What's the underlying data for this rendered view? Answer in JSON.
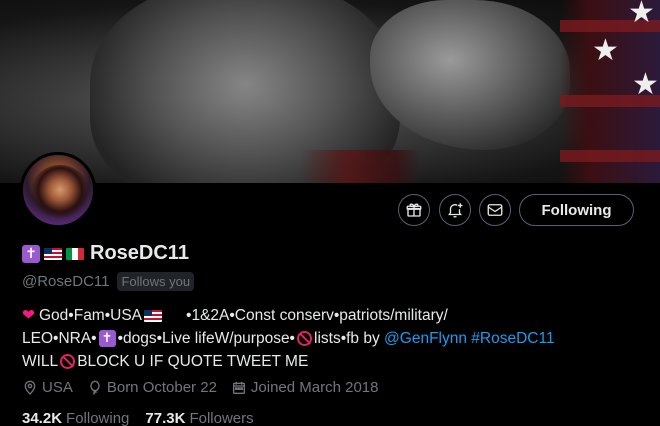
{
  "profile": {
    "display_name": "RoseDC11",
    "handle": "@RoseDC11",
    "follows_you": "Follows you",
    "follow_button": "Following",
    "bio": {
      "line1_text": "God•Fam•USA",
      "line1_tail": "•1&2A•Const conserv•patriots/military/",
      "line2_a": "LEO•NRA•",
      "line2_b": "•dogs•Live lifeW/purpose•",
      "line2_c": "lists•fb by ",
      "line2_link1": "@GenFlynn",
      "line2_link2": "#RoseDC11",
      "line3_a": "WILL",
      "line3_b": "BLOCK U IF QUOTE TWEET ME"
    },
    "location": "USA",
    "birthday": "Born October 22",
    "joined": "Joined March 2018",
    "following_count": "34.2K",
    "following_label": "Following",
    "followers_count": "77.3K",
    "followers_label": "Followers"
  },
  "icons": {
    "gift": "gift-icon",
    "notify": "bell-plus-icon",
    "message": "envelope-icon",
    "location": "location-pin-icon",
    "birthday": "balloon-icon",
    "calendar": "calendar-icon"
  },
  "colors": {
    "accent_link": "#1d9bf0",
    "muted": "#71767b",
    "badge_purple": "#9b59d0"
  }
}
